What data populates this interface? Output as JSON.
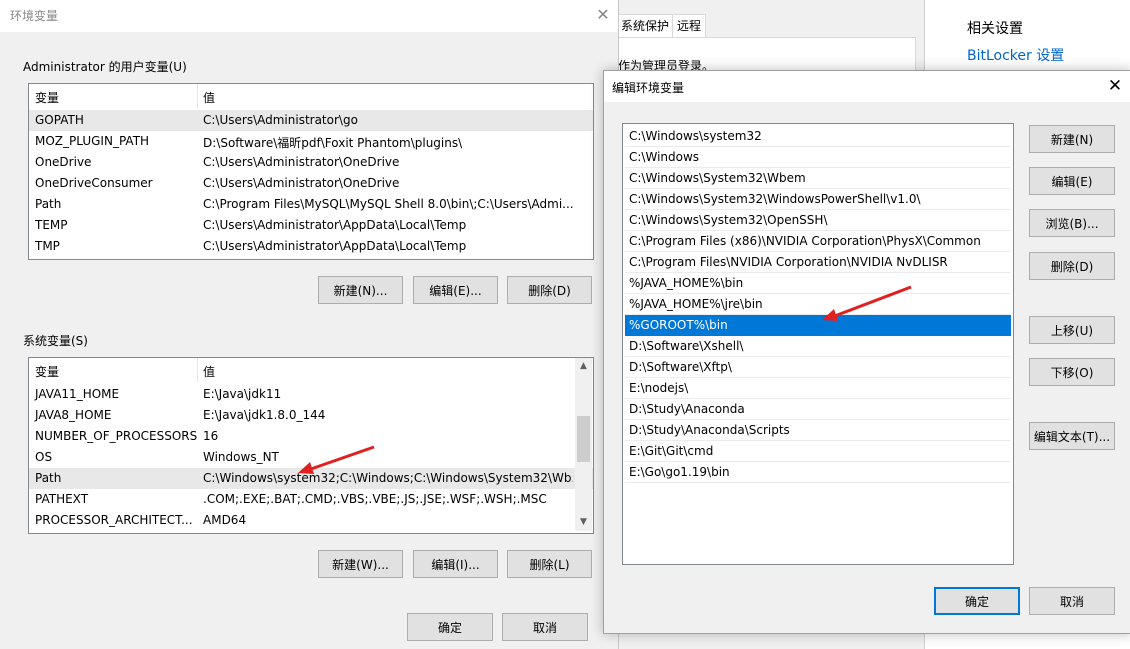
{
  "env_window": {
    "title": "环境变量",
    "user_group_label": "Administrator 的用户变量(U)",
    "system_group_label": "系统变量(S)",
    "col_variable": "变量",
    "col_value": "值",
    "user_vars": [
      {
        "name": "GOPATH",
        "value": "C:\\Users\\Administrator\\go"
      },
      {
        "name": "MOZ_PLUGIN_PATH",
        "value": "D:\\Software\\福昕pdf\\Foxit Phantom\\plugins\\"
      },
      {
        "name": "OneDrive",
        "value": "C:\\Users\\Administrator\\OneDrive"
      },
      {
        "name": "OneDriveConsumer",
        "value": "C:\\Users\\Administrator\\OneDrive"
      },
      {
        "name": "Path",
        "value": "C:\\Program Files\\MySQL\\MySQL Shell 8.0\\bin\\;C:\\Users\\Admi..."
      },
      {
        "name": "TEMP",
        "value": "C:\\Users\\Administrator\\AppData\\Local\\Temp"
      },
      {
        "name": "TMP",
        "value": "C:\\Users\\Administrator\\AppData\\Local\\Temp"
      }
    ],
    "system_vars": [
      {
        "name": "JAVA11_HOME",
        "value": "E:\\Java\\jdk11"
      },
      {
        "name": "JAVA8_HOME",
        "value": "E:\\Java\\jdk1.8.0_144"
      },
      {
        "name": "NUMBER_OF_PROCESSORS",
        "value": "16"
      },
      {
        "name": "OS",
        "value": "Windows_NT"
      },
      {
        "name": "Path",
        "value": "C:\\Windows\\system32;C:\\Windows;C:\\Windows\\System32\\Wb..."
      },
      {
        "name": "PATHEXT",
        "value": ".COM;.EXE;.BAT;.CMD;.VBS;.VBE;.JS;.JSE;.WSF;.WSH;.MSC"
      },
      {
        "name": "PROCESSOR_ARCHITECT...",
        "value": "AMD64"
      }
    ],
    "user_buttons": {
      "new": "新建(N)...",
      "edit": "编辑(E)...",
      "delete": "删除(D)"
    },
    "system_buttons": {
      "new": "新建(W)...",
      "edit": "编辑(I)...",
      "delete": "删除(L)"
    },
    "ok": "确定",
    "cancel": "取消"
  },
  "system_properties": {
    "tabs": [
      "系统保护",
      "远程"
    ],
    "admin_text": "作为管理员登录。"
  },
  "settings": {
    "related_title": "相关设置",
    "bitlocker_link": "BitLocker 设置"
  },
  "edit_dialog": {
    "title": "编辑环境变量",
    "paths": [
      "C:\\Windows\\system32",
      "C:\\Windows",
      "C:\\Windows\\System32\\Wbem",
      "C:\\Windows\\System32\\WindowsPowerShell\\v1.0\\",
      "C:\\Windows\\System32\\OpenSSH\\",
      "C:\\Program Files (x86)\\NVIDIA Corporation\\PhysX\\Common",
      "C:\\Program Files\\NVIDIA Corporation\\NVIDIA NvDLISR",
      "%JAVA_HOME%\\bin",
      "%JAVA_HOME%\\jre\\bin",
      "%GOROOT%\\bin",
      "D:\\Software\\Xshell\\",
      "D:\\Software\\Xftp\\",
      "E:\\nodejs\\",
      "D:\\Study\\Anaconda",
      "D:\\Study\\Anaconda\\Scripts",
      "E:\\Git\\Git\\cmd",
      "E:\\Go\\go1.19\\bin"
    ],
    "selected_index": 9,
    "buttons": {
      "new": "新建(N)",
      "edit": "编辑(E)",
      "browse": "浏览(B)...",
      "delete": "删除(D)",
      "move_up": "上移(U)",
      "move_down": "下移(O)",
      "edit_text": "编辑文本(T)..."
    },
    "ok": "确定",
    "cancel": "取消"
  },
  "colors": {
    "selection": "#0078d7",
    "arrow": "#e02020",
    "link": "#0066cc"
  }
}
